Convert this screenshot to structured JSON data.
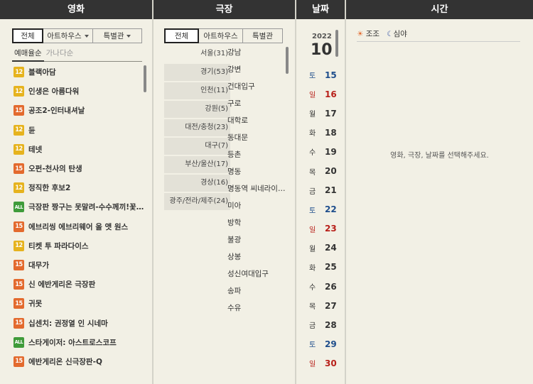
{
  "columns": {
    "movie": "영화",
    "theater": "극장",
    "date": "날짜",
    "time": "시간"
  },
  "movie_filters": [
    "전체",
    "아트하우스",
    "특별관"
  ],
  "sort_tabs": [
    "예매율순",
    "가나다순"
  ],
  "movies": [
    {
      "rating": "12",
      "title": "블랙아담"
    },
    {
      "rating": "12",
      "title": "인생은 아름다워"
    },
    {
      "rating": "15",
      "title": "공조2-인터내셔날"
    },
    {
      "rating": "12",
      "title": "듄"
    },
    {
      "rating": "12",
      "title": "테넷"
    },
    {
      "rating": "15",
      "title": "오펀-천사의 탄생"
    },
    {
      "rating": "12",
      "title": "정직한 후보2"
    },
    {
      "rating": "ALL",
      "title": "극장판 짱구는 못말려-수수께끼!꽃피는 천하떡잎학교"
    },
    {
      "rating": "15",
      "title": "에브리씽 에브리웨어 올 앳 원스"
    },
    {
      "rating": "12",
      "title": "티켓 투 파라다이스"
    },
    {
      "rating": "15",
      "title": "대무가"
    },
    {
      "rating": "15",
      "title": "신 에반게리온 극장판"
    },
    {
      "rating": "15",
      "title": "귀못"
    },
    {
      "rating": "15",
      "title": "십센치: 권정열 인 시네마"
    },
    {
      "rating": "ALL",
      "title": "스타게이저: 아스트로스코프"
    },
    {
      "rating": "15",
      "title": "에반게리온 신극장판-Q"
    }
  ],
  "theater_filters": [
    "전체",
    "아트하우스",
    "특별관"
  ],
  "regions": [
    "서울(31)",
    "경기(53)",
    "인천(11)",
    "강원(5)",
    "대전/충청(23)",
    "대구(7)",
    "부산/울산(17)",
    "경상(16)",
    "광주/전라/제주(24)"
  ],
  "branches": [
    "강남",
    "강변",
    "건대입구",
    "구로",
    "대학로",
    "동대문",
    "등촌",
    "명동",
    "명동역 씨네라이브러리",
    "미아",
    "방학",
    "불광",
    "상봉",
    "성신여대입구",
    "송파",
    "수유"
  ],
  "date": {
    "year": "2022",
    "month": "10",
    "days": [
      {
        "dow": "토",
        "num": "15",
        "type": "sat"
      },
      {
        "dow": "일",
        "num": "16",
        "type": "sun"
      },
      {
        "dow": "월",
        "num": "17",
        "type": ""
      },
      {
        "dow": "화",
        "num": "18",
        "type": ""
      },
      {
        "dow": "수",
        "num": "19",
        "type": ""
      },
      {
        "dow": "목",
        "num": "20",
        "type": ""
      },
      {
        "dow": "금",
        "num": "21",
        "type": ""
      },
      {
        "dow": "토",
        "num": "22",
        "type": "sat"
      },
      {
        "dow": "일",
        "num": "23",
        "type": "sun"
      },
      {
        "dow": "월",
        "num": "24",
        "type": ""
      },
      {
        "dow": "화",
        "num": "25",
        "type": ""
      },
      {
        "dow": "수",
        "num": "26",
        "type": ""
      },
      {
        "dow": "목",
        "num": "27",
        "type": ""
      },
      {
        "dow": "금",
        "num": "28",
        "type": ""
      },
      {
        "dow": "토",
        "num": "29",
        "type": "sat"
      },
      {
        "dow": "일",
        "num": "30",
        "type": "sun"
      }
    ]
  },
  "time": {
    "morning": "조조",
    "night": "심야",
    "message": "영화, 극장, 날짜를 선택해주세요."
  },
  "colors": {
    "header_bg": "#333333",
    "rating_12": "#e6b31e",
    "rating_15": "#e36a2e",
    "rating_all": "#3f9b3a",
    "saturday": "#1f4e8c",
    "sunday": "#b8201a"
  }
}
